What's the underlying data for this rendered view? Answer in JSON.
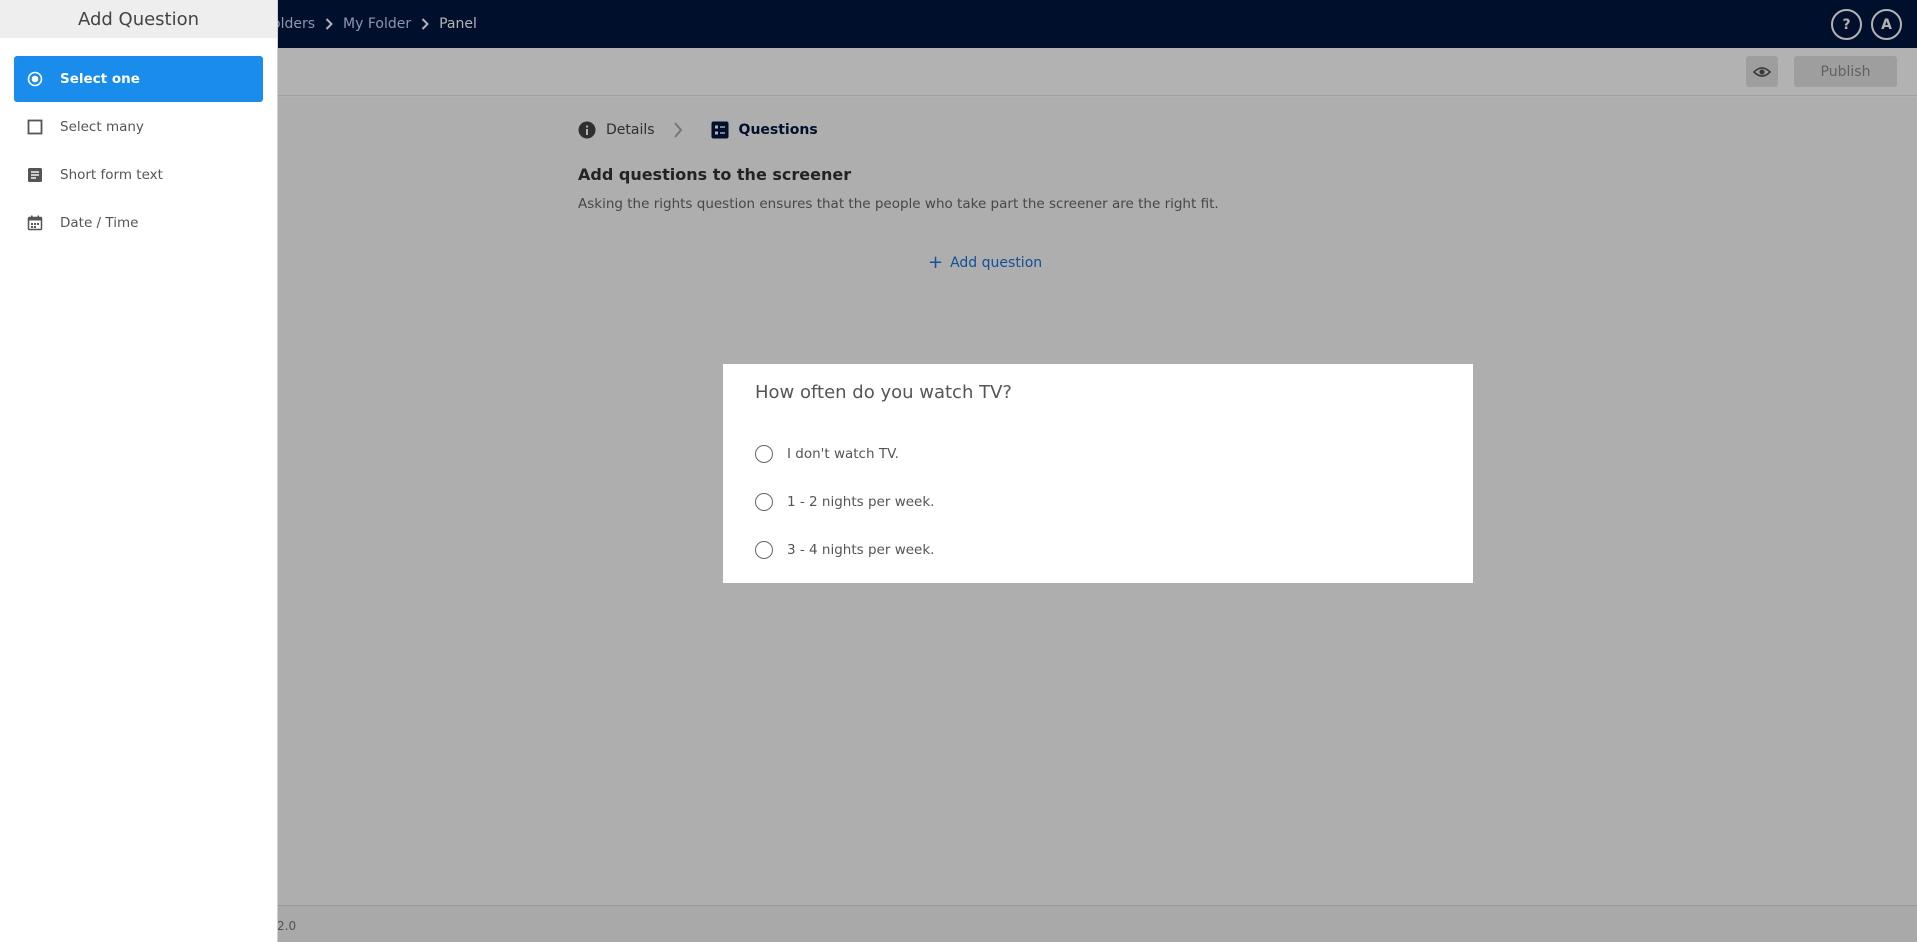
{
  "breadcrumb": {
    "items": [
      "olders",
      "My Folder"
    ],
    "current": "Panel"
  },
  "header": {
    "help_label": "?",
    "avatar_initial": "A"
  },
  "toolbar": {
    "publish_label": "Publish"
  },
  "steps": {
    "details": "Details",
    "questions": "Questions"
  },
  "main": {
    "title": "Add questions to the screener",
    "description": "Asking the rights question ensures that the people who take part the screener are the right fit.",
    "add_question_label": "Add question"
  },
  "footer": {
    "version": "2.0"
  },
  "preview": {
    "question": "How often do you watch TV?",
    "options": [
      "I don't watch TV.",
      "1 - 2 nights per week.",
      "3 - 4 nights per week."
    ]
  },
  "panel": {
    "title": "Add Question",
    "items": [
      {
        "label": "Select one",
        "icon": "radio-icon"
      },
      {
        "label": "Select many",
        "icon": "checkbox-icon"
      },
      {
        "label": "Short form text",
        "icon": "text-icon"
      },
      {
        "label": "Date / Time",
        "icon": "calendar-icon"
      }
    ],
    "active_index": 0
  },
  "colors": {
    "navy": "#011640",
    "accent": "#1a8ceb",
    "link": "#1a73d9"
  }
}
